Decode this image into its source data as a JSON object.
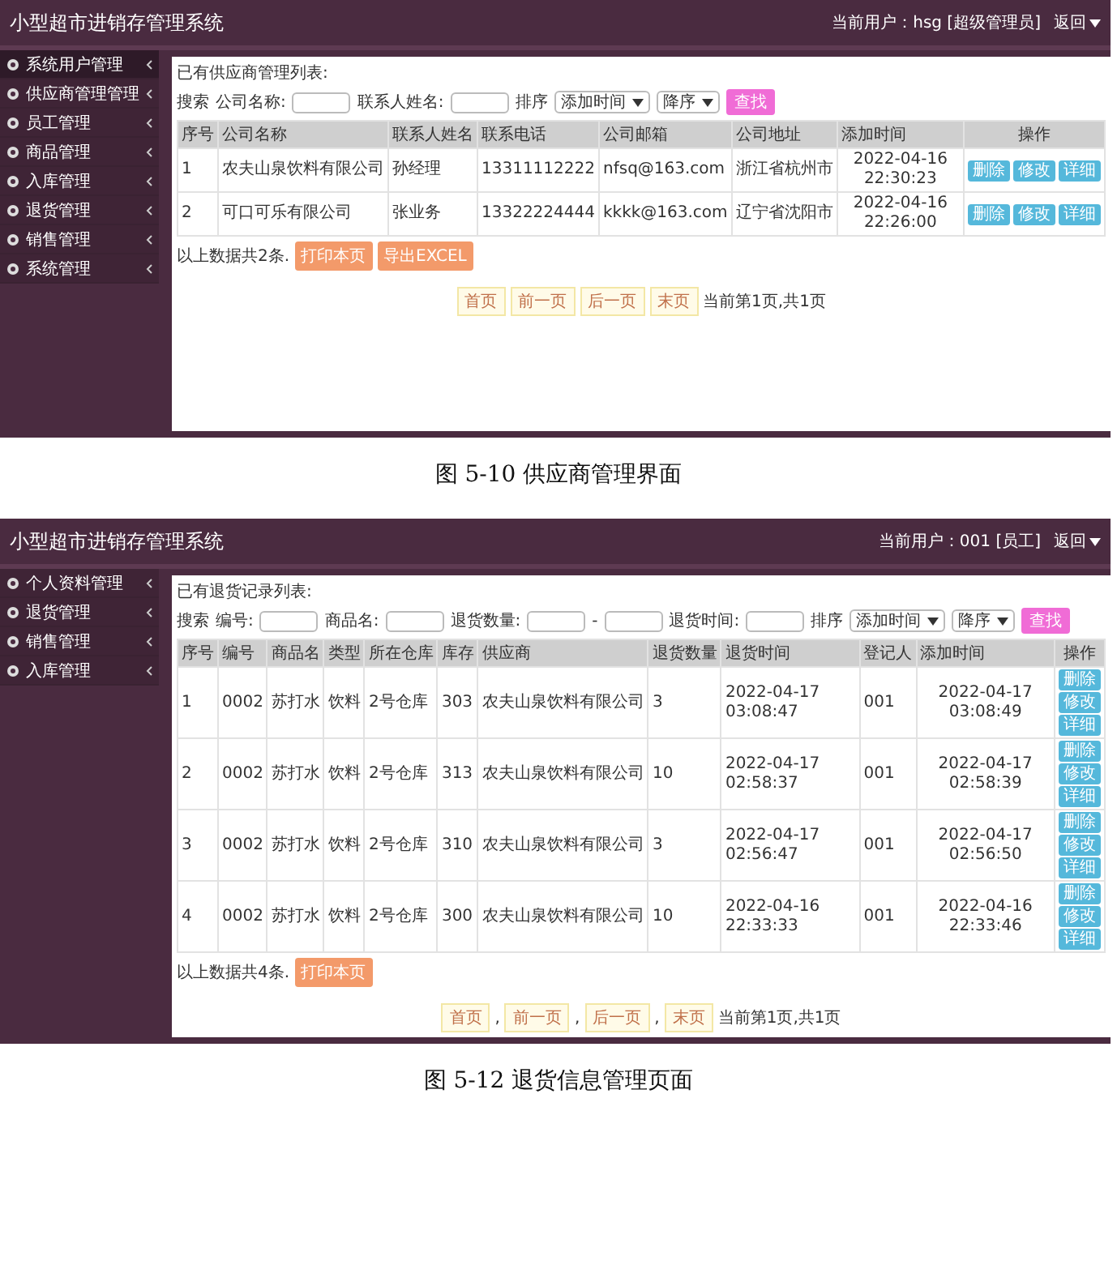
{
  "figures": [
    {
      "app": {
        "title": "小型超市进销存管理系统",
        "user_label": "当前用户：hsg [超级管理员]",
        "back_label": "返回",
        "sidebar": [
          {
            "label": "系统用户管理",
            "selected": true
          },
          {
            "label": "供应商管理管理",
            "selected": false
          },
          {
            "label": "员工管理",
            "selected": false
          },
          {
            "label": "商品管理",
            "selected": false
          },
          {
            "label": "入库管理",
            "selected": false
          },
          {
            "label": "退货管理",
            "selected": false
          },
          {
            "label": "销售管理",
            "selected": false
          },
          {
            "label": "系统管理",
            "selected": false
          }
        ],
        "list_title": "已有供应商管理列表:",
        "search": {
          "label": "搜索",
          "fields": [
            {
              "label": "公司名称:",
              "kind": "text"
            },
            {
              "label": "联系人姓名:",
              "kind": "text"
            }
          ],
          "sort_label": "排序",
          "sort_by": "添加时间",
          "order": "降序",
          "button": "查找"
        },
        "table": {
          "stacked_actions": false,
          "columns": [
            "序号",
            "公司名称",
            "联系人姓名",
            "联系电话",
            "公司邮箱",
            "公司地址",
            "添加时间",
            "操作"
          ],
          "rows": [
            {
              "cells": [
                "1",
                "农夫山泉饮料有限公司",
                "孙经理",
                "13311112222",
                "nfsq@163.com",
                "浙江省杭州市",
                "2022-04-16 22:30:23"
              ],
              "actions": [
                "删除",
                "修改",
                "详细"
              ]
            },
            {
              "cells": [
                "2",
                "可口可乐有限公司",
                "张业务",
                "13322224444",
                "kkkk@163.com",
                "辽宁省沈阳市",
                "2022-04-16 22:26:00"
              ],
              "actions": [
                "删除",
                "修改",
                "详细"
              ]
            }
          ]
        },
        "summary": "以上数据共2条.",
        "buttons": [
          "打印本页",
          "导出EXCEL"
        ],
        "pager": {
          "buttons": [
            "首页",
            "前一页",
            "后一页",
            "末页"
          ],
          "status": "当前第1页,共1页"
        }
      },
      "caption": "图 5-10 供应商管理界面"
    },
    {
      "app": {
        "title": "小型超市进销存管理系统",
        "user_label": "当前用户：001 [员工]",
        "back_label": "返回",
        "sidebar": [
          {
            "label": "个人资料管理",
            "selected": false
          },
          {
            "label": "退货管理",
            "selected": false
          },
          {
            "label": "销售管理",
            "selected": false
          },
          {
            "label": "入库管理",
            "selected": false
          }
        ],
        "list_title": "已有退货记录列表:",
        "search": {
          "label": "搜索",
          "fields": [
            {
              "label": "编号:",
              "kind": "text"
            },
            {
              "label": "商品名:",
              "kind": "text"
            },
            {
              "label": "退货数量:",
              "kind": "range",
              "separator": "-"
            },
            {
              "label": "退货时间:",
              "kind": "text"
            }
          ],
          "sort_label": "排序",
          "sort_by": "添加时间",
          "order": "降序",
          "button": "查找"
        },
        "table": {
          "stacked_actions": true,
          "columns": [
            "序号",
            "编号",
            "商品名",
            "类型",
            "所在仓库",
            "库存",
            "供应商",
            "退货数量",
            "退货时间",
            "登记人",
            "添加时间",
            "操作"
          ],
          "rows": [
            {
              "cells": [
                "1",
                "0002",
                "苏打水",
                "饮料",
                "2号仓库",
                "303",
                "农夫山泉饮料有限公司",
                "3",
                "2022-04-17 03:08:47",
                "001",
                "2022-04-17 03:08:49"
              ],
              "actions": [
                "删除",
                "修改",
                "详细"
              ]
            },
            {
              "cells": [
                "2",
                "0002",
                "苏打水",
                "饮料",
                "2号仓库",
                "313",
                "农夫山泉饮料有限公司",
                "10",
                "2022-04-17 02:58:37",
                "001",
                "2022-04-17 02:58:39"
              ],
              "actions": [
                "删除",
                "修改",
                "详细"
              ]
            },
            {
              "cells": [
                "3",
                "0002",
                "苏打水",
                "饮料",
                "2号仓库",
                "310",
                "农夫山泉饮料有限公司",
                "3",
                "2022-04-17 02:56:47",
                "001",
                "2022-04-17 02:56:50"
              ],
              "actions": [
                "删除",
                "修改",
                "详细"
              ]
            },
            {
              "cells": [
                "4",
                "0002",
                "苏打水",
                "饮料",
                "2号仓库",
                "300",
                "农夫山泉饮料有限公司",
                "10",
                "2022-04-16 22:33:33",
                "001",
                "2022-04-16 22:33:46"
              ],
              "actions": [
                "删除",
                "修改",
                "详细"
              ]
            }
          ]
        },
        "summary": "以上数据共4条.",
        "buttons": [
          "打印本页"
        ],
        "pager": {
          "buttons": [
            "首页",
            "前一页",
            "后一页",
            "末页"
          ],
          "separator": ",",
          "status": "当前第1页,共1页"
        }
      },
      "caption": "图 5-12 退货信息管理页面"
    }
  ]
}
